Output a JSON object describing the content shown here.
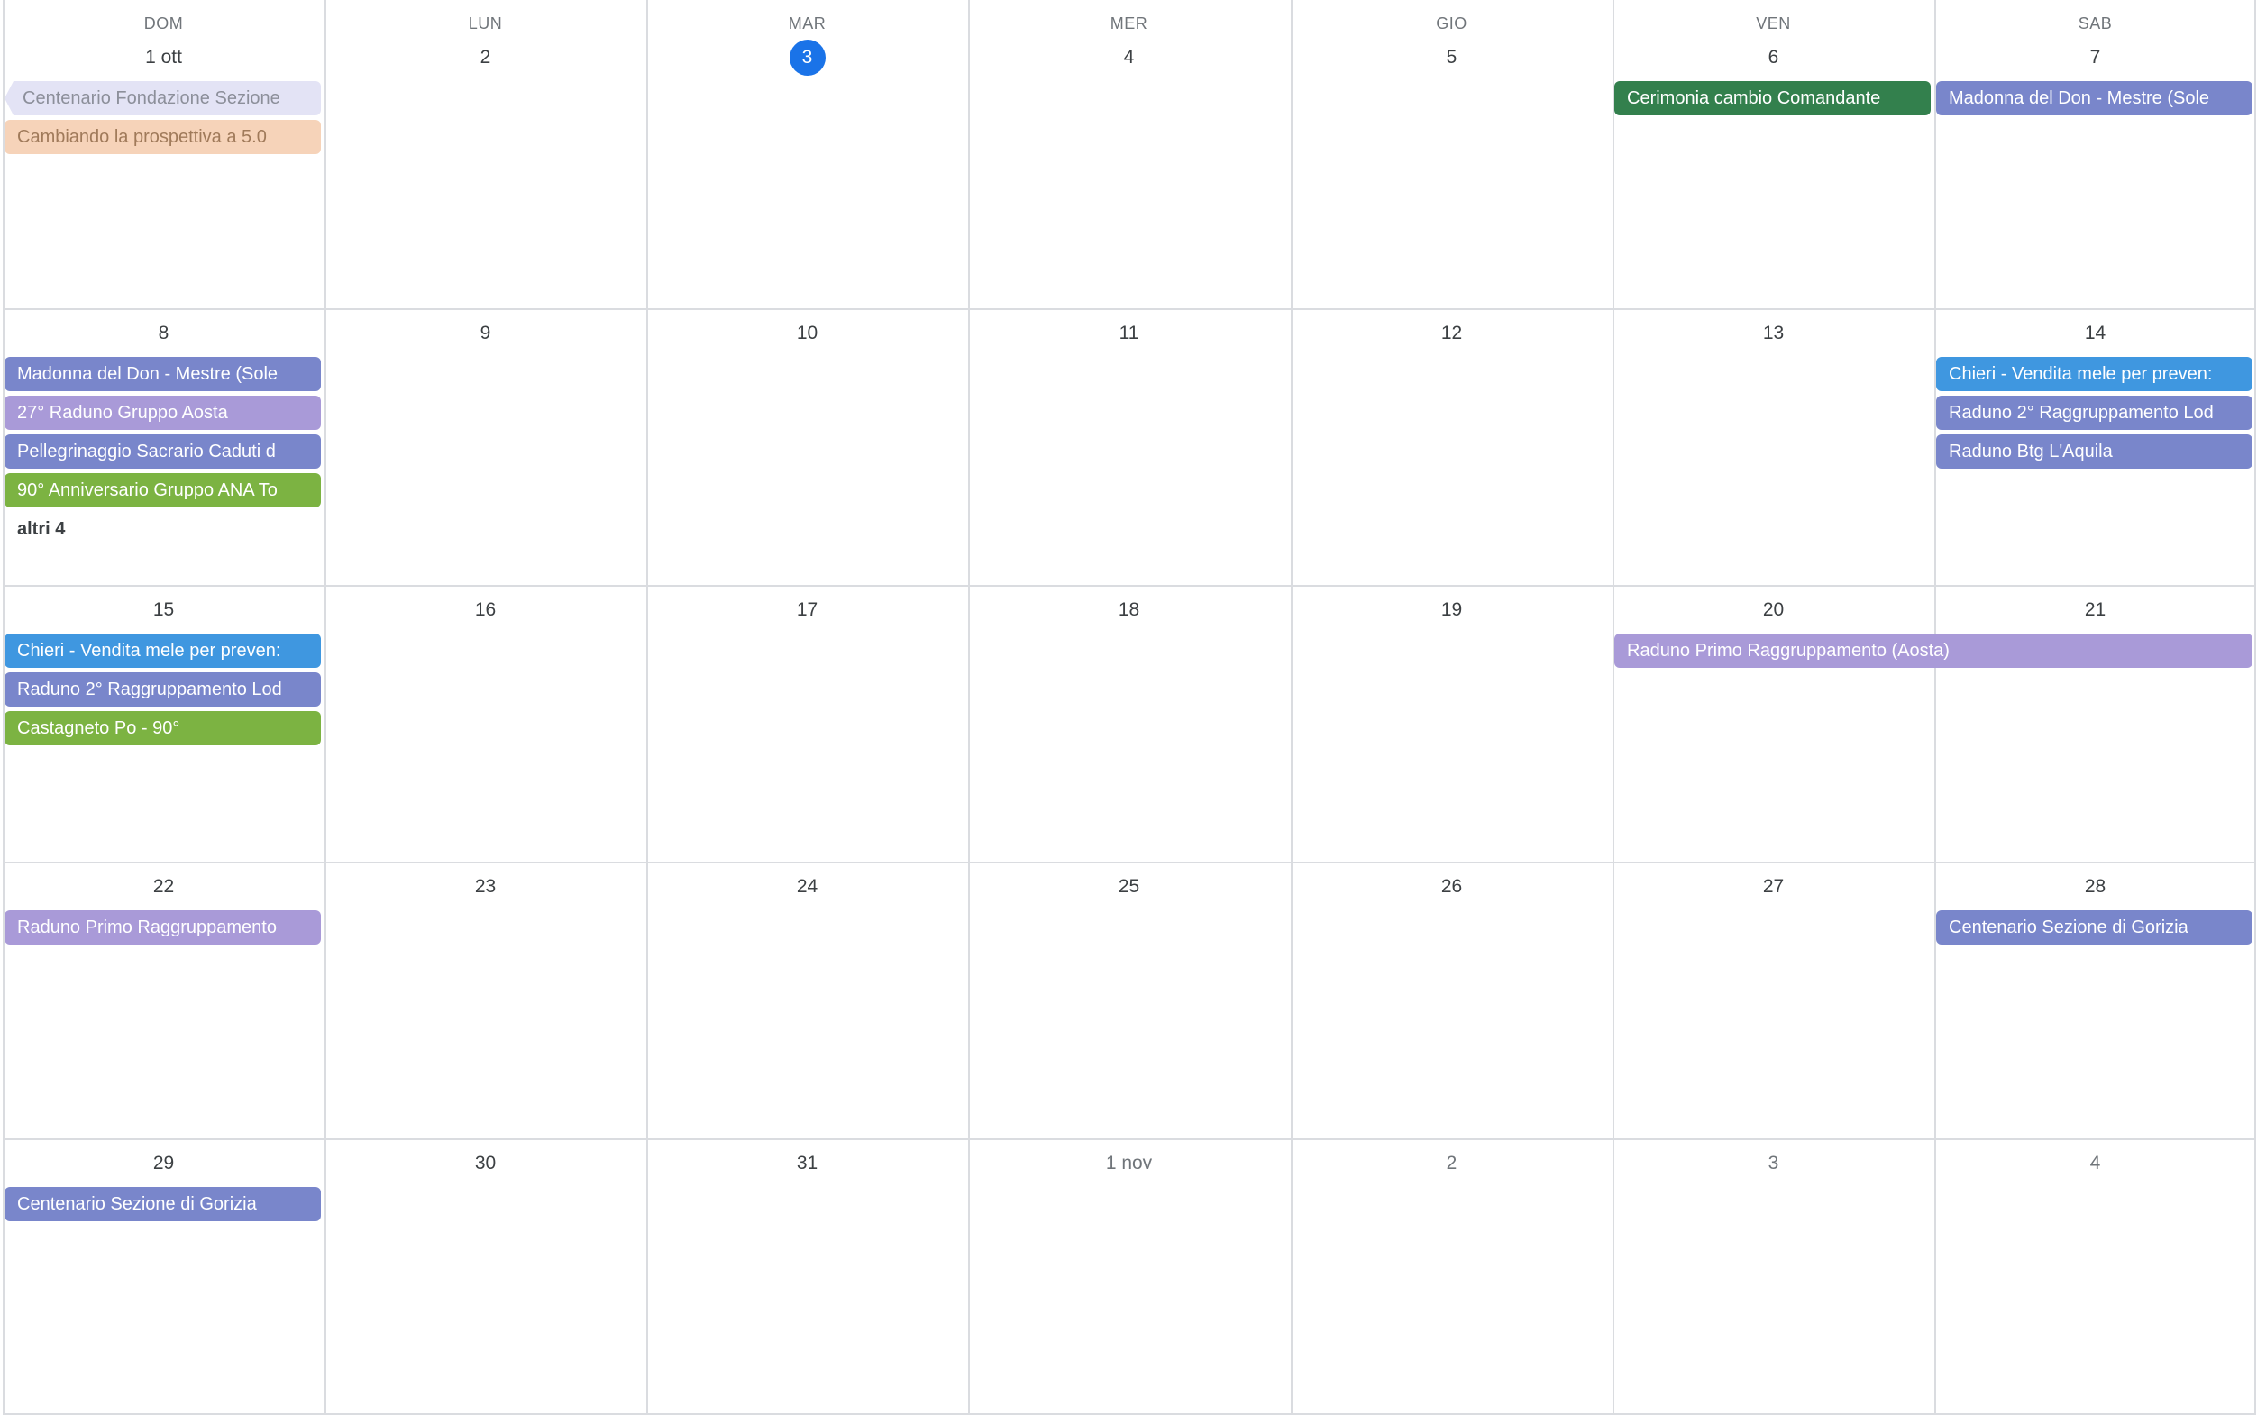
{
  "weekdays": [
    "DOM",
    "LUN",
    "MAR",
    "MER",
    "GIO",
    "VEN",
    "SAB"
  ],
  "weeks": [
    {
      "days": [
        {
          "label": "1 ott",
          "other": false,
          "today": false
        },
        {
          "label": "2",
          "other": false,
          "today": false
        },
        {
          "label": "3",
          "other": false,
          "today": true
        },
        {
          "label": "4",
          "other": false,
          "today": false
        },
        {
          "label": "5",
          "other": false,
          "today": false
        },
        {
          "label": "6",
          "other": false,
          "today": false
        },
        {
          "label": "7",
          "other": false,
          "today": false
        }
      ],
      "events": [
        {
          "title": "Centenario Fondazione Sezione",
          "day": 0,
          "span": 1,
          "slot": 0,
          "color": "#e3e3f5",
          "style": "pale",
          "continues": true
        },
        {
          "title": "Cambiando la prospettiva a 5.0",
          "day": 0,
          "span": 1,
          "slot": 1,
          "color": "#f6d3b9",
          "style": "peach"
        },
        {
          "title": "Cerimonia cambio Comandante",
          "day": 5,
          "span": 1,
          "slot": 0,
          "color": "#33804d"
        },
        {
          "title": "Madonna del Don - Mestre (Sole",
          "day": 6,
          "span": 1,
          "slot": 0,
          "color": "#7986cb"
        }
      ]
    },
    {
      "days": [
        {
          "label": "8",
          "other": false,
          "today": false
        },
        {
          "label": "9",
          "other": false,
          "today": false
        },
        {
          "label": "10",
          "other": false,
          "today": false
        },
        {
          "label": "11",
          "other": false,
          "today": false
        },
        {
          "label": "12",
          "other": false,
          "today": false
        },
        {
          "label": "13",
          "other": false,
          "today": false
        },
        {
          "label": "14",
          "other": false,
          "today": false
        }
      ],
      "events": [
        {
          "title": "Madonna del Don - Mestre (Sole",
          "day": 0,
          "span": 1,
          "slot": 0,
          "color": "#7986cb"
        },
        {
          "title": "27° Raduno Gruppo Aosta",
          "day": 0,
          "span": 1,
          "slot": 1,
          "color": "#a99ad8"
        },
        {
          "title": "Pellegrinaggio Sacrario Caduti d",
          "day": 0,
          "span": 1,
          "slot": 2,
          "color": "#7986cb"
        },
        {
          "title": "90° Anniversario Gruppo ANA To",
          "day": 0,
          "span": 1,
          "slot": 3,
          "color": "#7cb342"
        },
        {
          "title": "Chieri - Vendita mele per preven:",
          "day": 6,
          "span": 1,
          "slot": 0,
          "color": "#3f97e0"
        },
        {
          "title": "Raduno 2° Raggruppamento Lod",
          "day": 6,
          "span": 1,
          "slot": 1,
          "color": "#7986cb"
        },
        {
          "title": "Raduno Btg L'Aquila",
          "day": 6,
          "span": 1,
          "slot": 2,
          "color": "#7986cb"
        }
      ],
      "more": [
        {
          "label": "altri 4",
          "day": 0,
          "slot": 4
        }
      ]
    },
    {
      "days": [
        {
          "label": "15",
          "other": false,
          "today": false
        },
        {
          "label": "16",
          "other": false,
          "today": false
        },
        {
          "label": "17",
          "other": false,
          "today": false
        },
        {
          "label": "18",
          "other": false,
          "today": false
        },
        {
          "label": "19",
          "other": false,
          "today": false
        },
        {
          "label": "20",
          "other": false,
          "today": false
        },
        {
          "label": "21",
          "other": false,
          "today": false
        }
      ],
      "events": [
        {
          "title": "Chieri - Vendita mele per preven:",
          "day": 0,
          "span": 1,
          "slot": 0,
          "color": "#3f97e0"
        },
        {
          "title": "Raduno 2° Raggruppamento Lod",
          "day": 0,
          "span": 1,
          "slot": 1,
          "color": "#7986cb"
        },
        {
          "title": "Castagneto Po - 90°",
          "day": 0,
          "span": 1,
          "slot": 2,
          "color": "#7cb342"
        },
        {
          "title": "Raduno Primo Raggruppamento (Aosta)",
          "day": 5,
          "span": 2,
          "slot": 0,
          "color": "#a99ad8"
        }
      ]
    },
    {
      "days": [
        {
          "label": "22",
          "other": false,
          "today": false
        },
        {
          "label": "23",
          "other": false,
          "today": false
        },
        {
          "label": "24",
          "other": false,
          "today": false
        },
        {
          "label": "25",
          "other": false,
          "today": false
        },
        {
          "label": "26",
          "other": false,
          "today": false
        },
        {
          "label": "27",
          "other": false,
          "today": false
        },
        {
          "label": "28",
          "other": false,
          "today": false
        }
      ],
      "events": [
        {
          "title": "Raduno Primo Raggruppamento",
          "day": 0,
          "span": 1,
          "slot": 0,
          "color": "#a99ad8"
        },
        {
          "title": "Centenario Sezione di Gorizia",
          "day": 6,
          "span": 1,
          "slot": 0,
          "color": "#7986cb"
        }
      ]
    },
    {
      "days": [
        {
          "label": "29",
          "other": false,
          "today": false
        },
        {
          "label": "30",
          "other": false,
          "today": false
        },
        {
          "label": "31",
          "other": false,
          "today": false
        },
        {
          "label": "1 nov",
          "other": true,
          "today": false
        },
        {
          "label": "2",
          "other": true,
          "today": false
        },
        {
          "label": "3",
          "other": true,
          "today": false
        },
        {
          "label": "4",
          "other": true,
          "today": false
        }
      ],
      "events": [
        {
          "title": "Centenario Sezione di Gorizia",
          "day": 0,
          "span": 1,
          "slot": 0,
          "color": "#7986cb"
        }
      ]
    }
  ]
}
